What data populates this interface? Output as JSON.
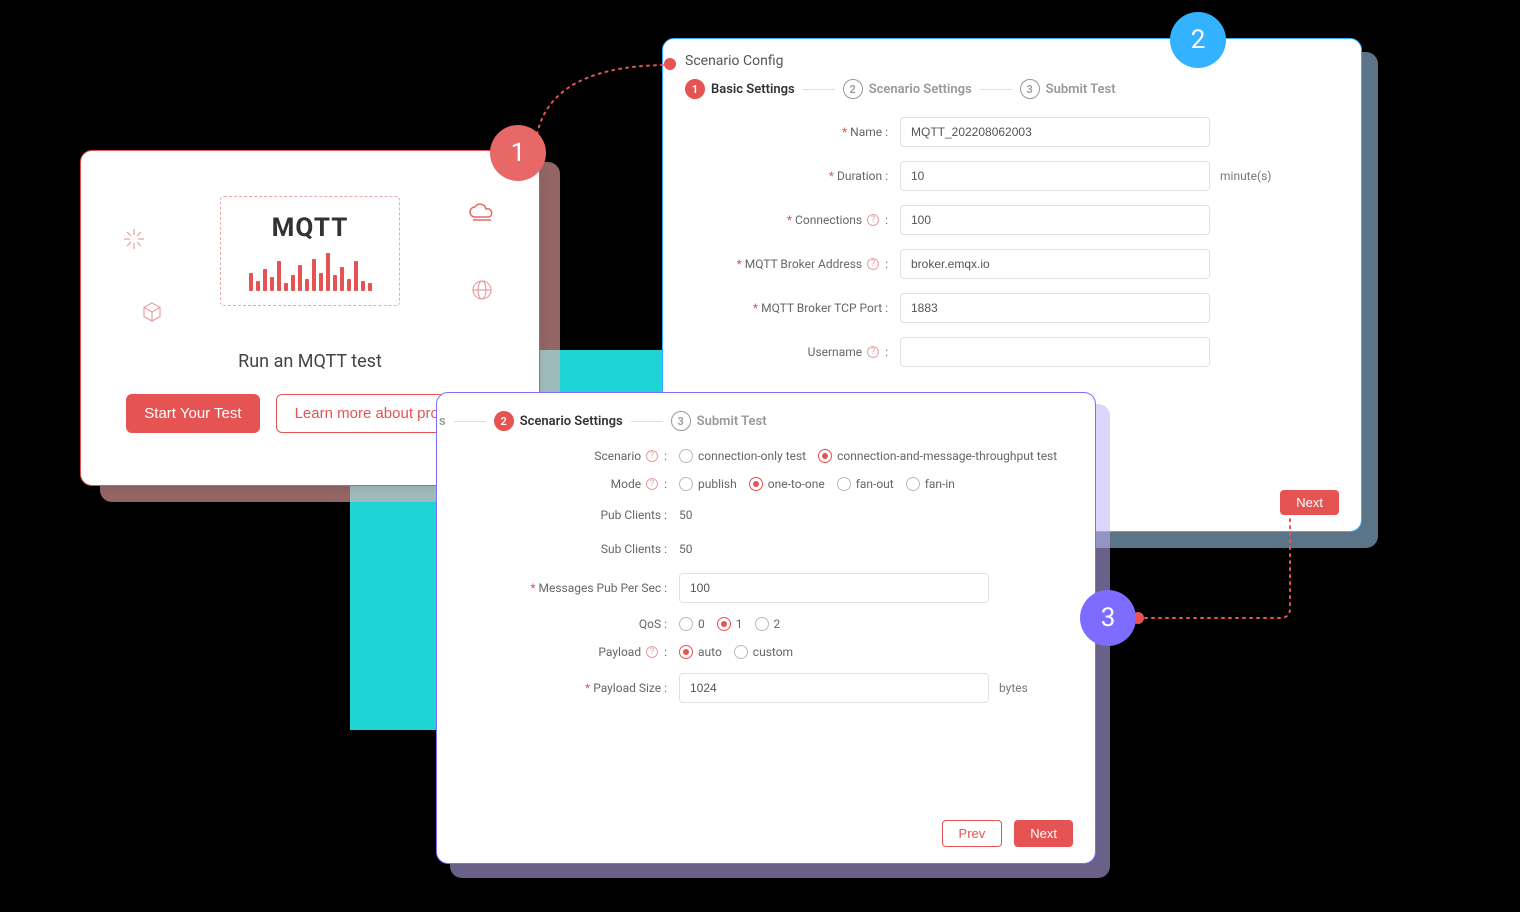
{
  "badges": {
    "one": "1",
    "two": "2",
    "three": "3"
  },
  "card1": {
    "mqtt_logo": "MQTT",
    "title": "Run an MQTT test",
    "start_btn": "Start Your Test",
    "learn_btn": "Learn more about products"
  },
  "card2": {
    "header": "Scenario Config",
    "step1": "Basic Settings",
    "step2": "Scenario Settings",
    "step3": "Submit Test",
    "step1_num": "1",
    "step2_num": "2",
    "step3_num": "3",
    "labels": {
      "name": "Name :",
      "duration": "Duration :",
      "connections": "Connections",
      "broker_addr": "MQTT Broker Address",
      "broker_port": "MQTT Broker TCP Port :",
      "username": "Username"
    },
    "values": {
      "name": "MQTT_202208062003",
      "duration": "10",
      "connections": "100",
      "broker_addr": "broker.emqx.io",
      "broker_port": "1883",
      "username": ""
    },
    "duration_suffix": "minute(s)",
    "next_btn": "Next"
  },
  "card3": {
    "step1_partial": "s",
    "step2": "Scenario Settings",
    "step3": "Submit Test",
    "step2_num": "2",
    "step3_num": "3",
    "labels": {
      "scenario": "Scenario",
      "mode": "Mode",
      "pub_clients": "Pub Clients :",
      "sub_clients": "Sub Clients :",
      "msgs_per_sec": "Messages Pub Per Sec :",
      "qos": "QoS :",
      "payload": "Payload",
      "payload_size": "Payload Size :"
    },
    "scenario_options": {
      "conn_only": "connection-only test",
      "conn_msg": "connection-and-message-throughput test"
    },
    "mode_options": {
      "publish": "publish",
      "one_to_one": "one-to-one",
      "fan_out": "fan-out",
      "fan_in": "fan-in"
    },
    "qos_options": {
      "q0": "0",
      "q1": "1",
      "q2": "2"
    },
    "payload_options": {
      "auto": "auto",
      "custom": "custom"
    },
    "values": {
      "pub_clients": "50",
      "sub_clients": "50",
      "msgs_per_sec": "100",
      "payload_size": "1024"
    },
    "payload_size_suffix": "bytes",
    "prev_btn": "Prev",
    "next_btn": "Next"
  }
}
